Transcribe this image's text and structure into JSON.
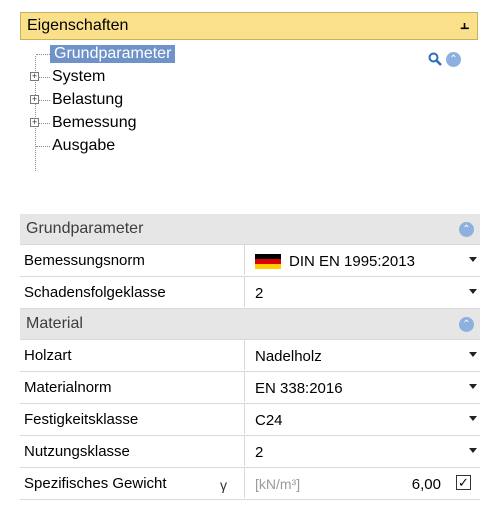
{
  "panel": {
    "title": "Eigenschaften",
    "pin_glyph": "ꟾ"
  },
  "tree": {
    "items": [
      {
        "label": "Grundparameter",
        "selected": true,
        "expandable": false
      },
      {
        "label": "System",
        "selected": false,
        "expandable": true
      },
      {
        "label": "Belastung",
        "selected": false,
        "expandable": true
      },
      {
        "label": "Bemessung",
        "selected": false,
        "expandable": true
      },
      {
        "label": "Ausgabe",
        "selected": false,
        "expandable": false
      }
    ],
    "icons": [
      "search-icon",
      "collapse-chevron-icon"
    ]
  },
  "sections": {
    "grundparameter": {
      "title": "Grundparameter",
      "rows": [
        {
          "name": "Bemessungsnorm",
          "value": "DIN EN 1995:2013"
        },
        {
          "name": "Schadensfolgeklasse",
          "value": "2"
        }
      ]
    },
    "material": {
      "title": "Material",
      "rows": [
        {
          "name": "Holzart",
          "value": "Nadelholz"
        },
        {
          "name": "Materialnorm",
          "value": "EN 338:2016"
        },
        {
          "name": "Festigkeitsklasse",
          "value": "C24"
        },
        {
          "name": "Nutzungsklasse",
          "value": "2"
        }
      ],
      "weight": {
        "name": "Spezifisches Gewicht",
        "symbol": "γ",
        "unit": "[kN/m³]",
        "value": "6,00",
        "checked": true
      }
    }
  },
  "colors": {
    "title_bg": "#fbe08c",
    "selection": "#6f93c9",
    "section_bg": "#e6e6e6",
    "chevron": "#8db0de"
  }
}
